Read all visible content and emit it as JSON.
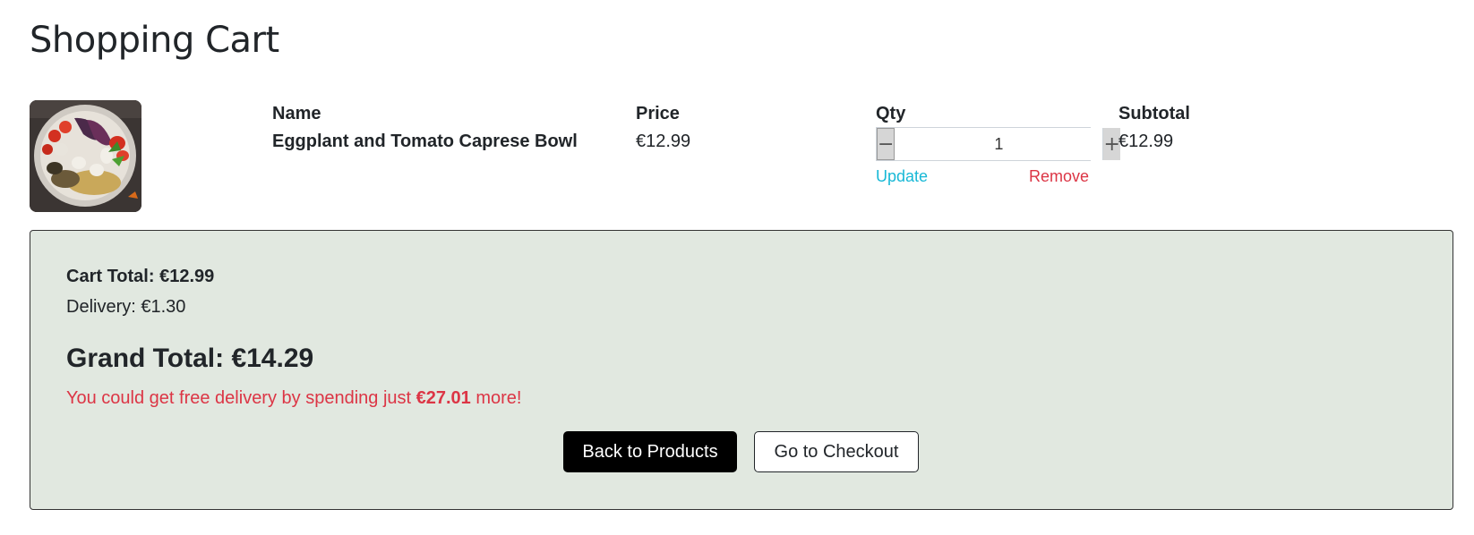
{
  "page": {
    "title": "Shopping Cart"
  },
  "cart": {
    "columns": {
      "name": "Name",
      "price": "Price",
      "qty": "Qty",
      "subtotal": "Subtotal"
    },
    "items": [
      {
        "image_icon": "food-bowl-image",
        "name": "Eggplant and Tomato Caprese Bowl",
        "price": "€12.99",
        "qty": "1",
        "subtotal": "€12.99",
        "decrement_symbol": "−",
        "increment_symbol": "+",
        "update_label": "Update",
        "remove_label": "Remove"
      }
    ]
  },
  "summary": {
    "cart_total": "Cart Total: €12.99",
    "delivery": "Delivery: €1.30",
    "grand_total": "Grand Total: €14.29",
    "free_delivery_prefix": "You could get free delivery by spending just ",
    "free_delivery_amount": "€27.01",
    "free_delivery_suffix": " more!",
    "back_button": "Back to Products",
    "checkout_button": "Go to Checkout"
  },
  "colors": {
    "summary_bg": "#e1e8e0",
    "update_link": "#17b8d6",
    "remove_link": "#dc3545",
    "warning_text": "#dc3545",
    "primary_button": "#000000"
  }
}
